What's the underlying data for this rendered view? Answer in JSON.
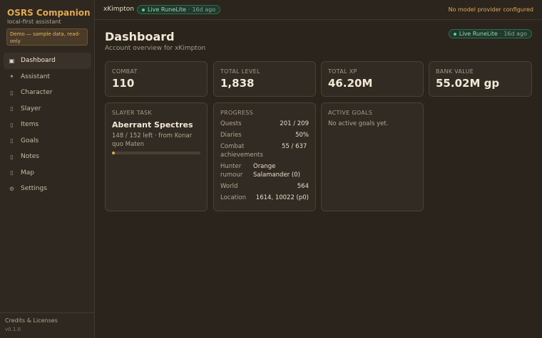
{
  "app": {
    "title": "OSRS Companion",
    "subtitle": "local-first assistant",
    "demo_notice": "Demo — sample data, read-only"
  },
  "nav": [
    {
      "label": "Dashboard",
      "icon": "▣",
      "active": true,
      "name": "dashboard"
    },
    {
      "label": "Assistant",
      "icon": "✦",
      "active": false,
      "name": "assistant"
    },
    {
      "label": "Character",
      "icon": "▯",
      "active": false,
      "name": "character"
    },
    {
      "label": "Slayer",
      "icon": "▯",
      "active": false,
      "name": "slayer"
    },
    {
      "label": "Items",
      "icon": "▯",
      "active": false,
      "name": "items"
    },
    {
      "label": "Goals",
      "icon": "▯",
      "active": false,
      "name": "goals"
    },
    {
      "label": "Notes",
      "icon": "▯",
      "active": false,
      "name": "notes"
    },
    {
      "label": "Map",
      "icon": "▯",
      "active": false,
      "name": "map"
    },
    {
      "label": "Settings",
      "icon": "⚙",
      "active": false,
      "name": "settings"
    }
  ],
  "footer": {
    "credits": "Credits & Licenses",
    "version": "v0.1.0"
  },
  "topbar": {
    "username": "xKimpton",
    "status_label": "Live RuneLite",
    "status_ago": "16d ago",
    "provider_notice": "No model provider configured"
  },
  "page": {
    "title": "Dashboard",
    "subtitle": "Account overview for xKimpton"
  },
  "stats": [
    {
      "label": "COMBAT",
      "value": "110"
    },
    {
      "label": "TOTAL LEVEL",
      "value": "1,838"
    },
    {
      "label": "TOTAL XP",
      "value": "46.20M"
    },
    {
      "label": "BANK VALUE",
      "value": "55.02M gp"
    }
  ],
  "slayer": {
    "label": "SLAYER TASK",
    "monster": "Aberrant Spectres",
    "detail": "148 / 152 left · from Konar quo Maten",
    "progress_fraction": 0.026
  },
  "progress": {
    "label": "PROGRESS",
    "rows": [
      {
        "key": "Quests",
        "value": "201 / 209"
      },
      {
        "key": "Diaries",
        "value": "50%"
      },
      {
        "key": "Combat achievements",
        "value": "55 / 637"
      },
      {
        "key": "Hunter rumour",
        "value": "Orange Salamander (0)"
      },
      {
        "key": "World",
        "value": "564"
      },
      {
        "key": "Location",
        "value": "1614, 10022 (p0)"
      }
    ]
  },
  "goals": {
    "label": "ACTIVE GOALS",
    "empty": "No active goals yet."
  },
  "colors": {
    "accent": "#e3a94f",
    "live": "#5fd08f"
  }
}
